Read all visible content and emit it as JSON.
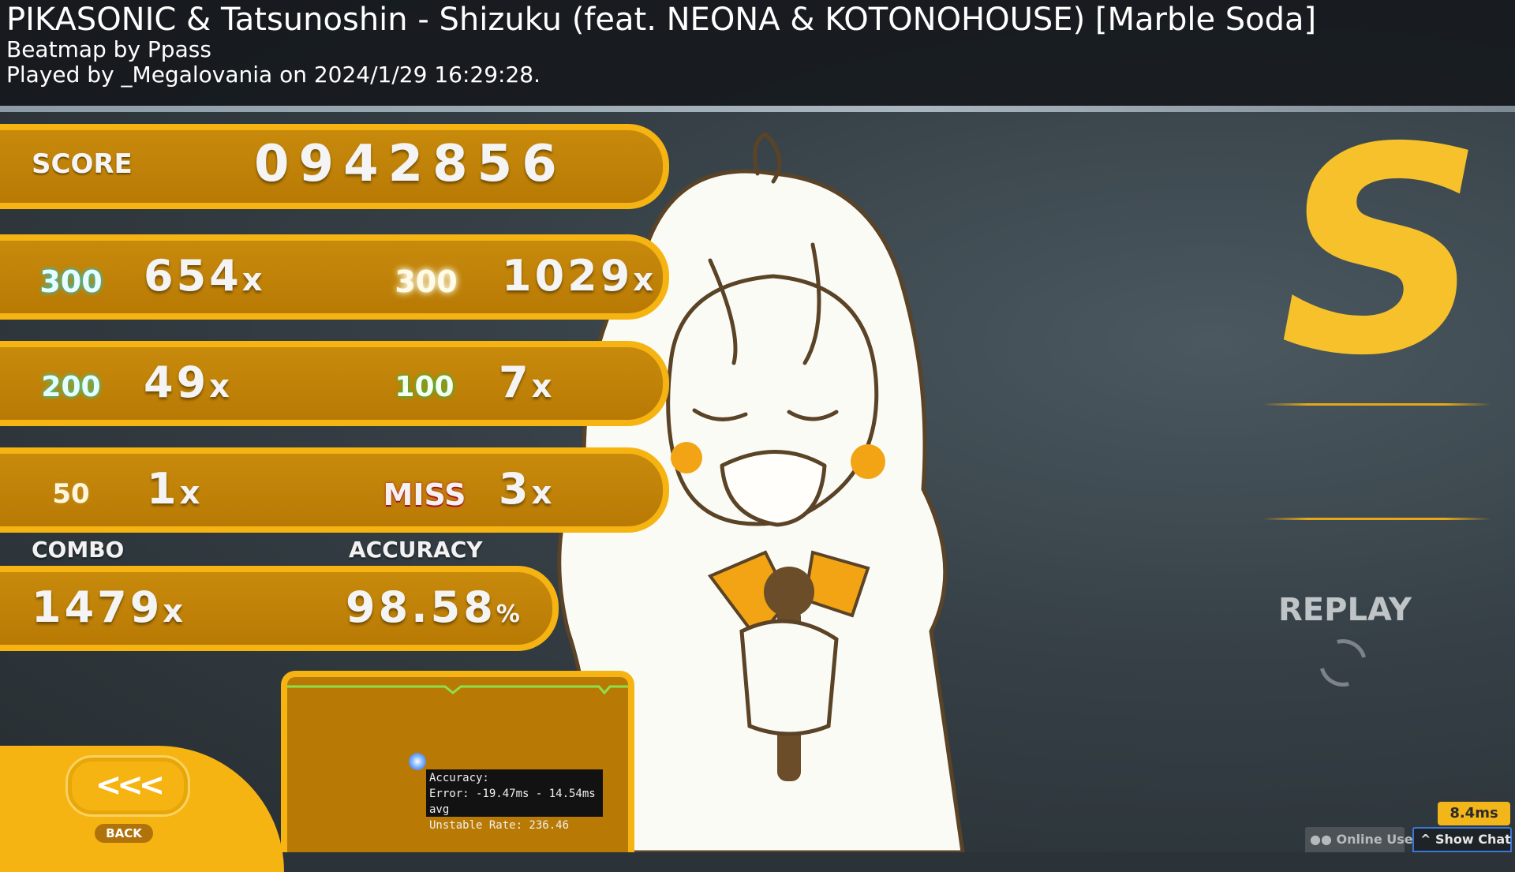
{
  "header": {
    "title": "PIKASONIC & Tatsunoshin - Shizuku (feat. NEONA & KOTONOHOUSE) [Marble Soda]",
    "mapper": "Beatmap by Ppass",
    "played": "Played by _Megalovania on 2024/1/29 16:29:28."
  },
  "score": {
    "label": "SCORE",
    "value": "0942856"
  },
  "hits": {
    "h300": {
      "icon": "300",
      "count": "654",
      "unit": "x"
    },
    "h300g": {
      "icon": "300",
      "count": "1029",
      "unit": "x"
    },
    "h200": {
      "icon": "200",
      "count": "49",
      "unit": "x"
    },
    "h100": {
      "icon": "100",
      "count": "7",
      "unit": "x"
    },
    "h50": {
      "icon": "50",
      "count": "1",
      "unit": "x"
    },
    "miss": {
      "icon": "MISS",
      "count": "3",
      "unit": "x"
    }
  },
  "combo": {
    "label": "COMBO",
    "value": "1479",
    "unit": "x"
  },
  "accuracy": {
    "label": "ACCURACY",
    "value": "98.58",
    "unit": "%"
  },
  "tooltip": {
    "line1": "Accuracy:",
    "line2": "Error: -19.47ms - 14.54ms avg",
    "line3": "Unstable Rate: 236.46"
  },
  "back": {
    "arrow": "<<<",
    "label": "BACK"
  },
  "rank": {
    "grade": "S",
    "color": "#f6c12a"
  },
  "replay": {
    "label": "REPLAY"
  },
  "footer": {
    "frametime": "8.4ms",
    "online_users": "Online Users",
    "show_chat": "Show Chat"
  },
  "colors": {
    "panel": "#b87a04",
    "panel_border": "#f6b412"
  }
}
